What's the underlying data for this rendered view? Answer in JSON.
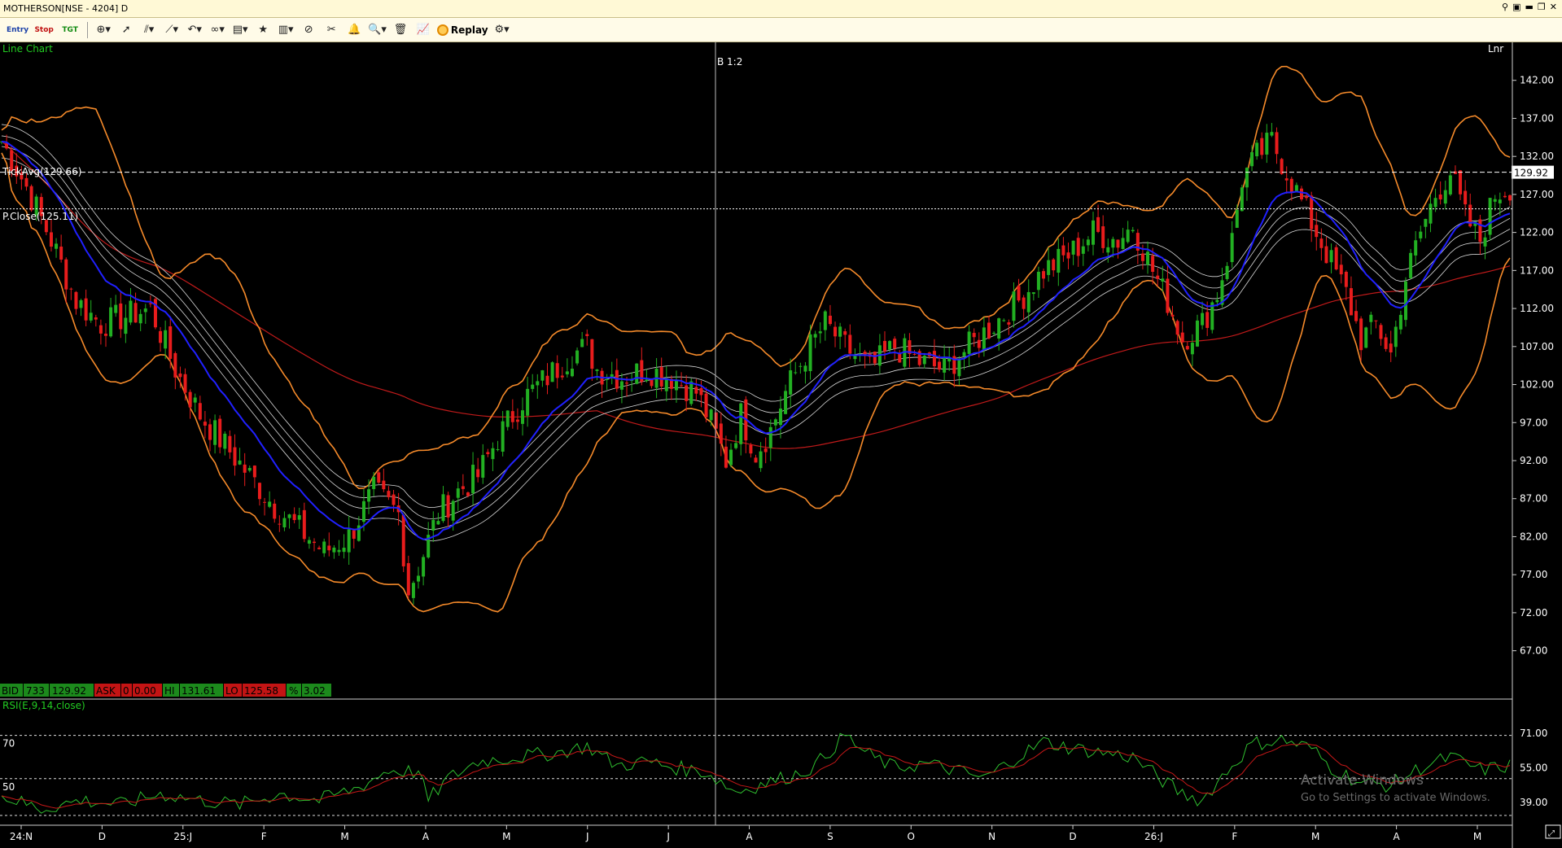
{
  "window": {
    "title": "MOTHERSON[NSE - 4204] D"
  },
  "toolbar": {
    "entry_label": "Entry",
    "stop_label": "Stop",
    "tgt_label": "TGT",
    "replay_label": "Replay"
  },
  "chart_data": {
    "type": "line",
    "chart_type_label": "Line Chart",
    "scale_label": "Lnr",
    "crosshair_label": "B 1:2",
    "tick_avg_label": "TickAvg(129.66)",
    "tick_avg": 129.66,
    "prev_close_label": "P.Close(125.11)",
    "prev_close": 125.11,
    "last_price_label": "129.92",
    "last_price": 129.92,
    "ylim": [
      63,
      147
    ],
    "y_ticks": [
      "142.00",
      "137.00",
      "132.00",
      "127.00",
      "122.00",
      "117.00",
      "112.00",
      "107.00",
      "102.00",
      "97.00",
      "92.00",
      "87.00",
      "82.00",
      "77.00",
      "72.00",
      "67.00"
    ],
    "x_ticks": [
      "24:N",
      "D",
      "25:J",
      "F",
      "M",
      "A",
      "M",
      "J",
      "J",
      "A",
      "S",
      "O",
      "N",
      "D",
      "26:J",
      "F",
      "M",
      "A",
      "M"
    ],
    "price_anchors": [
      [
        0,
        134
      ],
      [
        5,
        128
      ],
      [
        10,
        121
      ],
      [
        15,
        113
      ],
      [
        20,
        110
      ],
      [
        25,
        111
      ],
      [
        30,
        112
      ],
      [
        35,
        104
      ],
      [
        40,
        98
      ],
      [
        45,
        94
      ],
      [
        50,
        90
      ],
      [
        55,
        86
      ],
      [
        60,
        83
      ],
      [
        65,
        80
      ],
      [
        70,
        82
      ],
      [
        75,
        88
      ],
      [
        80,
        85
      ],
      [
        82,
        75
      ],
      [
        84,
        78
      ],
      [
        88,
        85
      ],
      [
        92,
        88
      ],
      [
        96,
        90
      ],
      [
        100,
        95
      ],
      [
        105,
        100
      ],
      [
        110,
        103
      ],
      [
        115,
        106
      ],
      [
        118,
        107
      ],
      [
        120,
        104
      ],
      [
        125,
        103
      ],
      [
        130,
        104
      ],
      [
        135,
        103
      ],
      [
        140,
        101
      ],
      [
        143,
        97
      ],
      [
        146,
        92
      ],
      [
        149,
        98
      ],
      [
        152,
        93
      ],
      [
        155,
        96
      ],
      [
        158,
        101
      ],
      [
        162,
        106
      ],
      [
        166,
        110
      ],
      [
        170,
        107
      ],
      [
        175,
        104
      ],
      [
        180,
        107
      ],
      [
        185,
        105
      ],
      [
        190,
        104
      ],
      [
        195,
        107
      ],
      [
        200,
        110
      ],
      [
        205,
        113
      ],
      [
        210,
        117
      ],
      [
        215,
        119
      ],
      [
        220,
        122
      ],
      [
        225,
        121
      ],
      [
        228,
        123
      ],
      [
        232,
        117
      ],
      [
        235,
        113
      ],
      [
        238,
        108
      ],
      [
        242,
        110
      ],
      [
        245,
        114
      ],
      [
        248,
        121
      ],
      [
        250,
        129
      ],
      [
        253,
        132
      ],
      [
        256,
        134
      ],
      [
        259,
        130
      ],
      [
        262,
        126
      ],
      [
        265,
        122
      ],
      [
        268,
        118
      ],
      [
        271,
        114
      ],
      [
        274,
        108
      ],
      [
        277,
        110
      ],
      [
        280,
        106
      ],
      [
        283,
        116
      ],
      [
        286,
        122
      ],
      [
        289,
        127
      ],
      [
        292,
        130
      ],
      [
        295,
        124
      ],
      [
        298,
        121
      ],
      [
        301,
        127
      ],
      [
        304,
        128
      ]
    ],
    "bid": {
      "label": "BID",
      "qty": "733",
      "price": "129.92"
    },
    "ask": {
      "label": "ASK",
      "qty": "0",
      "price": "0.00"
    },
    "hi": {
      "label": "HI",
      "value": "131.61"
    },
    "lo": {
      "label": "LO",
      "value": "125.58"
    },
    "pct": {
      "label": "%",
      "value": "3.02"
    },
    "rsi": {
      "label": "RSI(E,9,14,close)",
      "ylim": [
        30,
        80
      ],
      "y_ticks": [
        "71.00",
        "55.00",
        "39.00"
      ],
      "level_labels": [
        "70",
        "50"
      ],
      "levels": [
        70,
        50,
        33
      ],
      "anchors": [
        [
          0,
          42
        ],
        [
          8,
          36
        ],
        [
          16,
          40
        ],
        [
          24,
          38
        ],
        [
          32,
          43
        ],
        [
          40,
          40
        ],
        [
          48,
          38
        ],
        [
          56,
          43
        ],
        [
          64,
          40
        ],
        [
          72,
          46
        ],
        [
          78,
          54
        ],
        [
          84,
          53
        ],
        [
          86,
          40
        ],
        [
          90,
          50
        ],
        [
          96,
          58
        ],
        [
          104,
          60
        ],
        [
          112,
          62
        ],
        [
          118,
          65
        ],
        [
          124,
          56
        ],
        [
          130,
          58
        ],
        [
          136,
          55
        ],
        [
          142,
          53
        ],
        [
          148,
          44
        ],
        [
          154,
          48
        ],
        [
          160,
          52
        ],
        [
          164,
          56
        ],
        [
          170,
          70
        ],
        [
          174,
          62
        ],
        [
          180,
          55
        ],
        [
          186,
          57
        ],
        [
          192,
          54
        ],
        [
          198,
          50
        ],
        [
          204,
          59
        ],
        [
          210,
          67
        ],
        [
          216,
          64
        ],
        [
          222,
          62
        ],
        [
          228,
          60
        ],
        [
          234,
          49
        ],
        [
          238,
          43
        ],
        [
          242,
          40
        ],
        [
          246,
          51
        ],
        [
          252,
          66
        ],
        [
          258,
          68
        ],
        [
          264,
          64
        ],
        [
          268,
          55
        ],
        [
          274,
          48
        ],
        [
          280,
          47
        ],
        [
          286,
          55
        ],
        [
          292,
          60
        ],
        [
          298,
          54
        ],
        [
          304,
          56
        ]
      ]
    }
  },
  "watermark": {
    "title": "Activate Windows",
    "subtitle": "Go to Settings to activate Windows."
  },
  "colors": {
    "bull": "#22b022",
    "bear": "#e81c1c",
    "ema": "#2020ff",
    "bollinger": "#f58a2a",
    "long_ma": "#c01a1a",
    "envelope": "#d8d8d8",
    "rsi_line": "#2fbf2f",
    "rsi_signal": "#c81818"
  }
}
